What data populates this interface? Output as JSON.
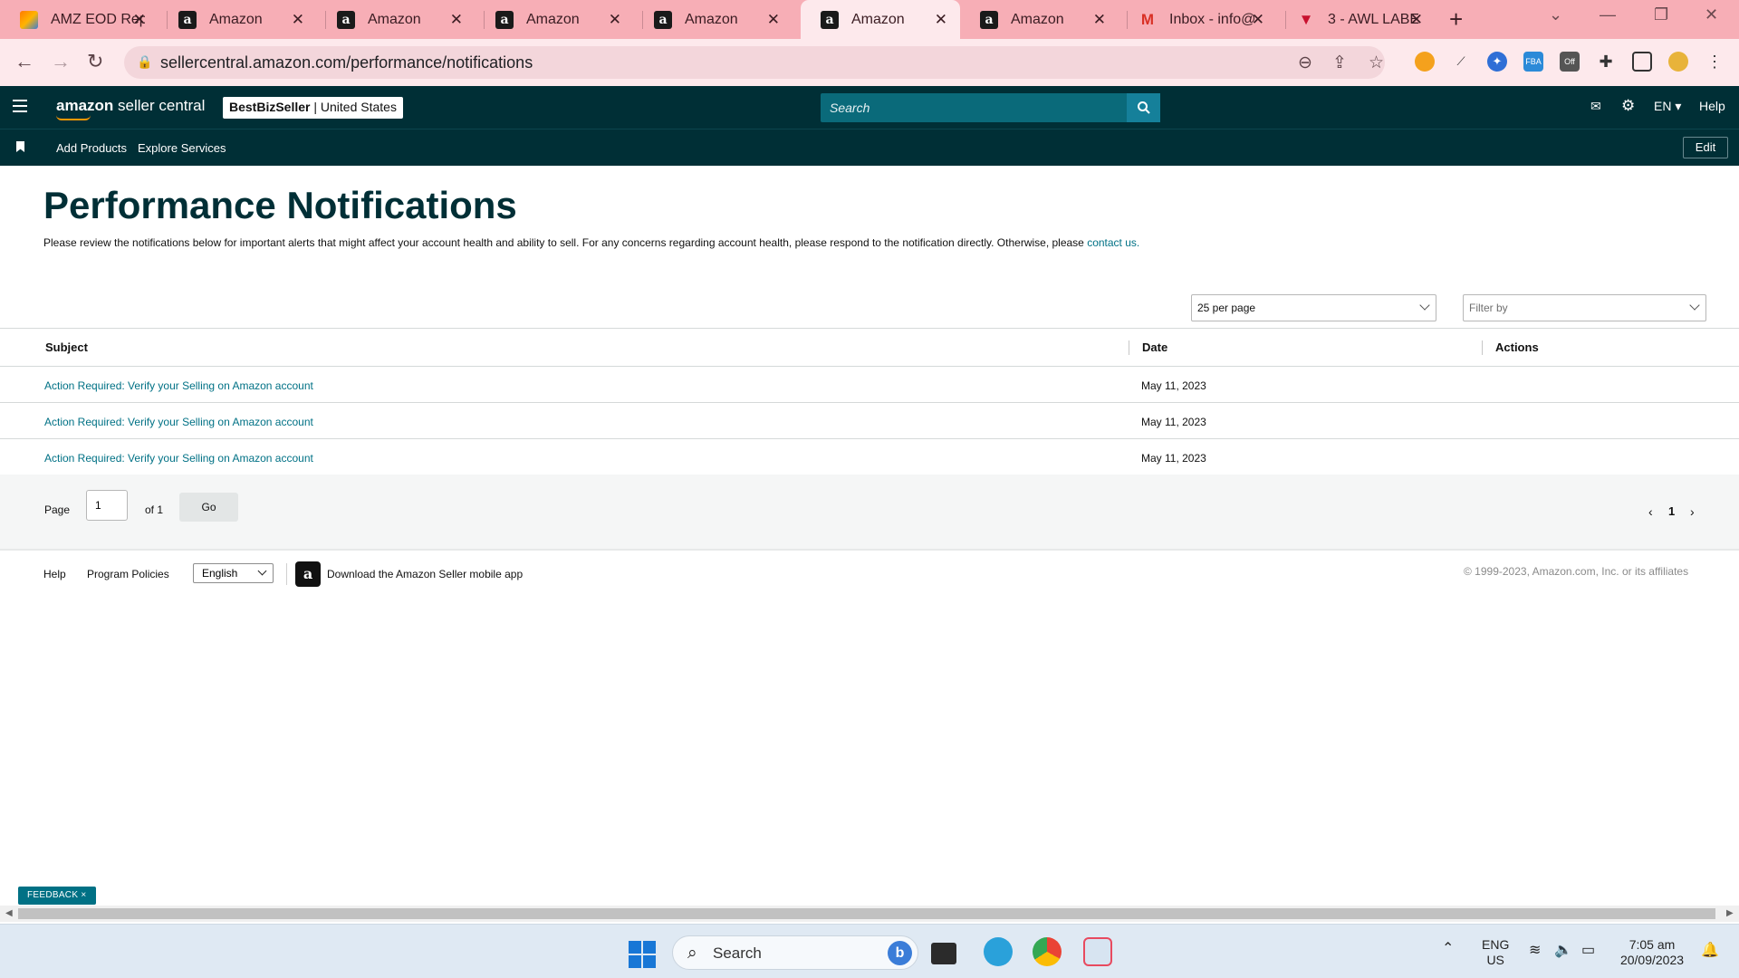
{
  "browser": {
    "tabs": [
      {
        "title": "AMZ EOD Rep",
        "icon": "app-icon",
        "x": 0
      },
      {
        "title": "Amazon",
        "icon": "amazon-icon"
      },
      {
        "title": "Amazon",
        "icon": "amazon-icon"
      },
      {
        "title": "Amazon",
        "icon": "amazon-icon"
      },
      {
        "title": "Amazon",
        "icon": "amazon-icon"
      },
      {
        "title": "Amazon",
        "icon": "amazon-icon",
        "active": true
      },
      {
        "title": "Amazon",
        "icon": "amazon-icon"
      },
      {
        "title": "Inbox - info@",
        "icon": "gmail-icon"
      },
      {
        "title": "3 - AWL LABE",
        "icon": "awl-icon"
      }
    ],
    "url": "sellercentral.amazon.com/performance/notifications",
    "extension_badge": "Off"
  },
  "header": {
    "logo_text_bold": "amazon",
    "logo_text": " seller central",
    "account_name": "BestBizSeller",
    "account_region": " | United States",
    "search_placeholder": "Search",
    "language": "EN",
    "help": "Help",
    "nav": [
      "Add Products",
      "Explore Services"
    ],
    "edit": "Edit"
  },
  "page": {
    "title": "Performance Notifications",
    "description": "Please review the notifications below for important alerts that might affect your account health and ability to sell. For any concerns regarding account health, please respond to the notification directly. Otherwise, please",
    "contact_link": "contact us.",
    "per_page": "25 per page",
    "filter_placeholder": "Filter by"
  },
  "table": {
    "columns": [
      "Subject",
      "Date",
      "Actions"
    ],
    "rows": [
      {
        "subject": "Action Required: Verify your Selling on Amazon account",
        "date": "May 11, 2023"
      },
      {
        "subject": "Action Required: Verify your Selling on Amazon account",
        "date": "May 11, 2023"
      },
      {
        "subject": "Action Required: Verify your Selling on Amazon account",
        "date": "May 11, 2023"
      }
    ]
  },
  "pagination": {
    "page_label": "Page",
    "page_value": "1",
    "of_label": "of 1",
    "go": "Go",
    "current": "1"
  },
  "footer": {
    "help": "Help",
    "policies": "Program Policies",
    "language": "English",
    "app_text": "Download the Amazon Seller mobile app",
    "copyright": "© 1999-2023, Amazon.com, Inc. or its affiliates"
  },
  "feedback": "FEEDBACK ×",
  "taskbar": {
    "search": "Search",
    "lang_top": "ENG",
    "lang_bottom": "US",
    "time": "7:05 am",
    "date": "20/09/2023"
  }
}
